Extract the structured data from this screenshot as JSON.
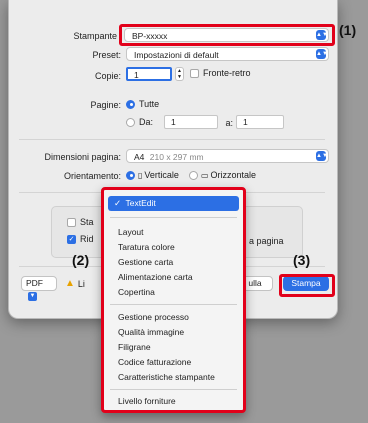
{
  "printer": {
    "label": "Stampante",
    "value": "BP-xxxxx"
  },
  "preset": {
    "label": "Preset:",
    "value": "Impostazioni di default"
  },
  "copies": {
    "label": "Copie:",
    "value": "1",
    "duplex_label": "Fronte-retro"
  },
  "pages": {
    "label": "Pagine:",
    "all_label": "Tutte",
    "from_label": "Da:",
    "from_value": "1",
    "to_label": "a:",
    "to_value": "1"
  },
  "paper_size": {
    "label": "Dimensioni pagina:",
    "value": "A4",
    "dims": "210 x 297 mm"
  },
  "orientation": {
    "label": "Orientamento:",
    "portrait": "Verticale",
    "landscape": "Orizzontale"
  },
  "options_partial": {
    "opt1": "Sta",
    "opt2": "Rid",
    "right_text": "a pagina"
  },
  "footer": {
    "pdf_label": "PDF",
    "warning_partial": "Li",
    "cancel_partial": "ulla",
    "print_label": "Stampa"
  },
  "menu": {
    "selected": "TextEdit",
    "group1": [
      "Layout",
      "Taratura colore",
      "Gestione carta",
      "Alimentazione carta",
      "Copertina"
    ],
    "group2": [
      "Gestione processo",
      "Qualità immagine",
      "Filigrane",
      "Codice fatturazione",
      "Caratteristiche stampante"
    ],
    "group3": [
      "Livello forniture"
    ]
  },
  "callouts": {
    "c1": "(1)",
    "c2": "(2)",
    "c3": "(3)"
  },
  "colors": {
    "accent": "#2c6fe4",
    "highlight": "#e2001a"
  }
}
